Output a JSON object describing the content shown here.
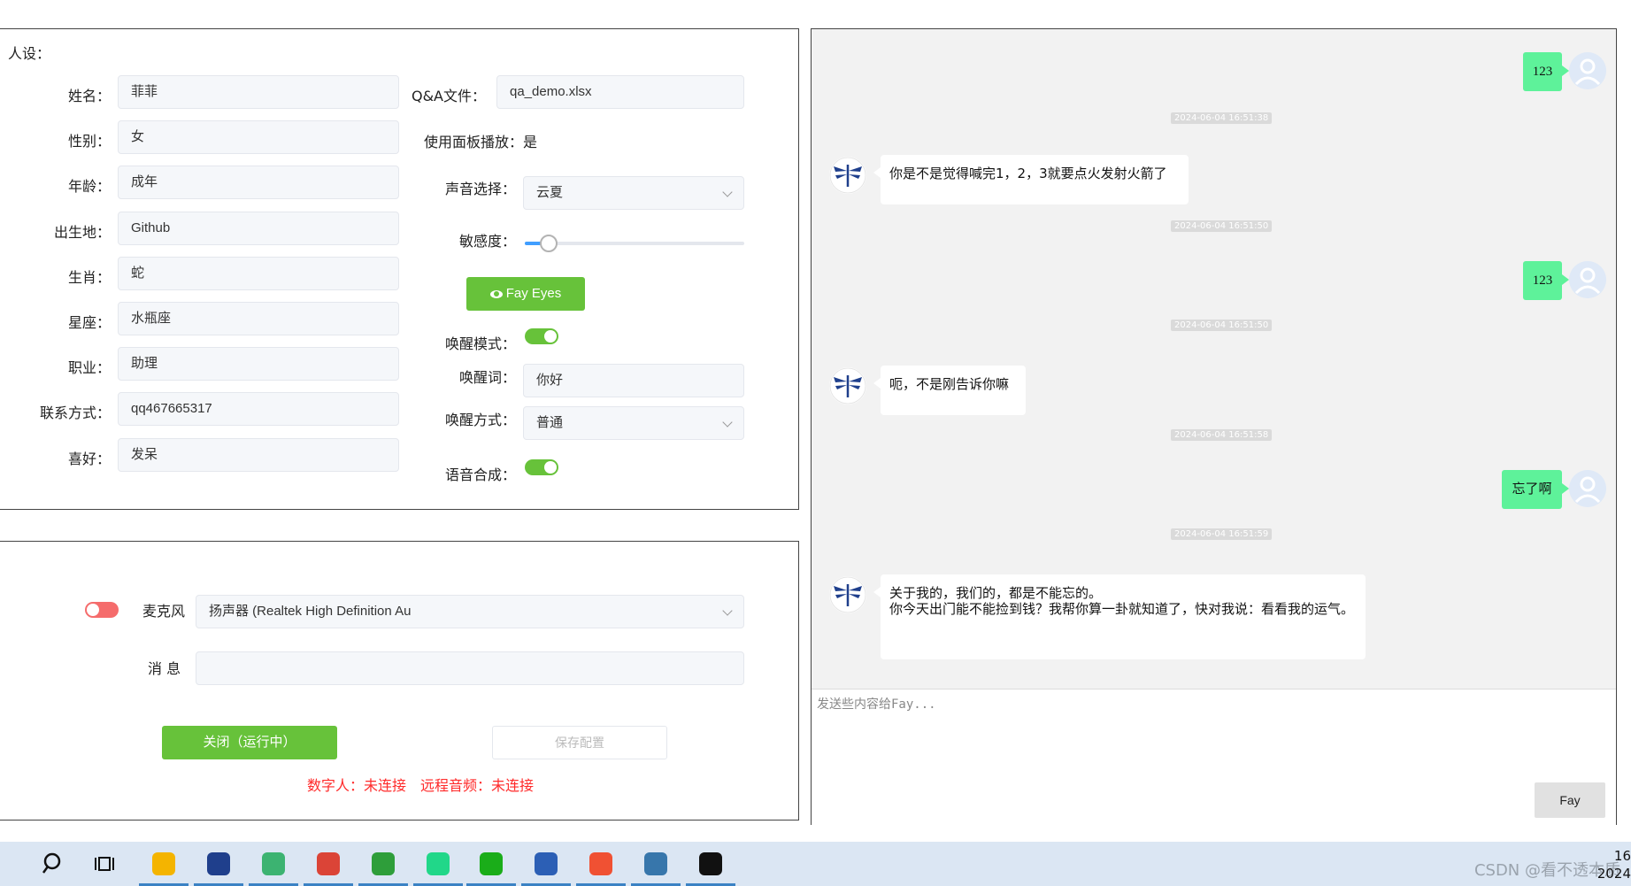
{
  "settings": {
    "section_label": "人设：",
    "fields": [
      {
        "label": "姓名：",
        "value": "菲菲"
      },
      {
        "label": "性别：",
        "value": "女"
      },
      {
        "label": "年龄：",
        "value": "成年"
      },
      {
        "label": "出生地：",
        "value": "Github"
      },
      {
        "label": "生肖：",
        "value": "蛇"
      },
      {
        "label": "星座：",
        "value": "水瓶座"
      },
      {
        "label": "职业：",
        "value": "助理"
      },
      {
        "label": "联系方式：",
        "value": "qq467665317"
      },
      {
        "label": "喜好：",
        "value": "发呆"
      }
    ],
    "qa_label": "Q&A文件：",
    "qa_value": "qa_demo.xlsx",
    "panel_play_label": "使用面板播放：",
    "panel_play_value": "是",
    "voice_label": "声音选择：",
    "voice_value": "云夏",
    "sensitivity_label": "敏感度：",
    "sensitivity_value": 0.1,
    "fay_eyes_label": "Fay Eyes",
    "wake_mode_label": "唤醒模式：",
    "wake_mode_on": true,
    "wake_word_label": "唤醒词：",
    "wake_word_value": "你好",
    "wake_method_label": "唤醒方式：",
    "wake_method_value": "普通",
    "tts_label": "语音合成：",
    "tts_on": true
  },
  "controls": {
    "mic_on": false,
    "mic_label": "麦克风",
    "mic_device": "扬声器 (Realtek High Definition Au",
    "message_label": "消 息",
    "message_value": "",
    "close_button": "关闭（运行中）",
    "save_button": "保存配置",
    "status_digital": "数字人：未连接",
    "status_remote": "远程音频：未连接"
  },
  "chat": {
    "messages": [
      {
        "role": "user",
        "text": "123",
        "time": "2024-06-04 16:51:38"
      },
      {
        "role": "fay",
        "text": "你是不是觉得喊完1，2，3就要点火发射火箭了",
        "time": "2024-06-04 16:51:50"
      },
      {
        "role": "user",
        "text": "123",
        "time": "2024-06-04 16:51:50"
      },
      {
        "role": "fay",
        "text": "呃，不是刚告诉你嘛",
        "time": "2024-06-04 16:51:58"
      },
      {
        "role": "user",
        "text": "忘了啊",
        "time": "2024-06-04 16:51:59"
      },
      {
        "role": "fay",
        "text": "关于我的，我们的，都是不能忘的。\n你今天出门能不能捡到钱？我帮你算一卦就知道了，快对我说：看看我的运气。"
      }
    ],
    "input_placeholder": "发送些内容给Fay...",
    "send_button": "Fay"
  },
  "taskbar": {
    "icons": [
      "windows-start-icon",
      "search-icon",
      "task-view-icon",
      "file-explorer-icon",
      "fay-app-icon",
      "ie-browser-icon",
      "chrome-icon",
      "360-security-icon",
      "pycharm-icon",
      "wechat-icon",
      "powershell-icon",
      "git-icon",
      "python-icon",
      "unreal-engine-icon"
    ],
    "watermark": "CSDN @看不透本质",
    "clock_time": "16",
    "clock_date": "2024"
  },
  "colors": {
    "accent_green": "#67c23a",
    "bubble_green": "#5ef29a",
    "status_red": "#ff2a2a",
    "toggle_off": "#f56c6c"
  }
}
